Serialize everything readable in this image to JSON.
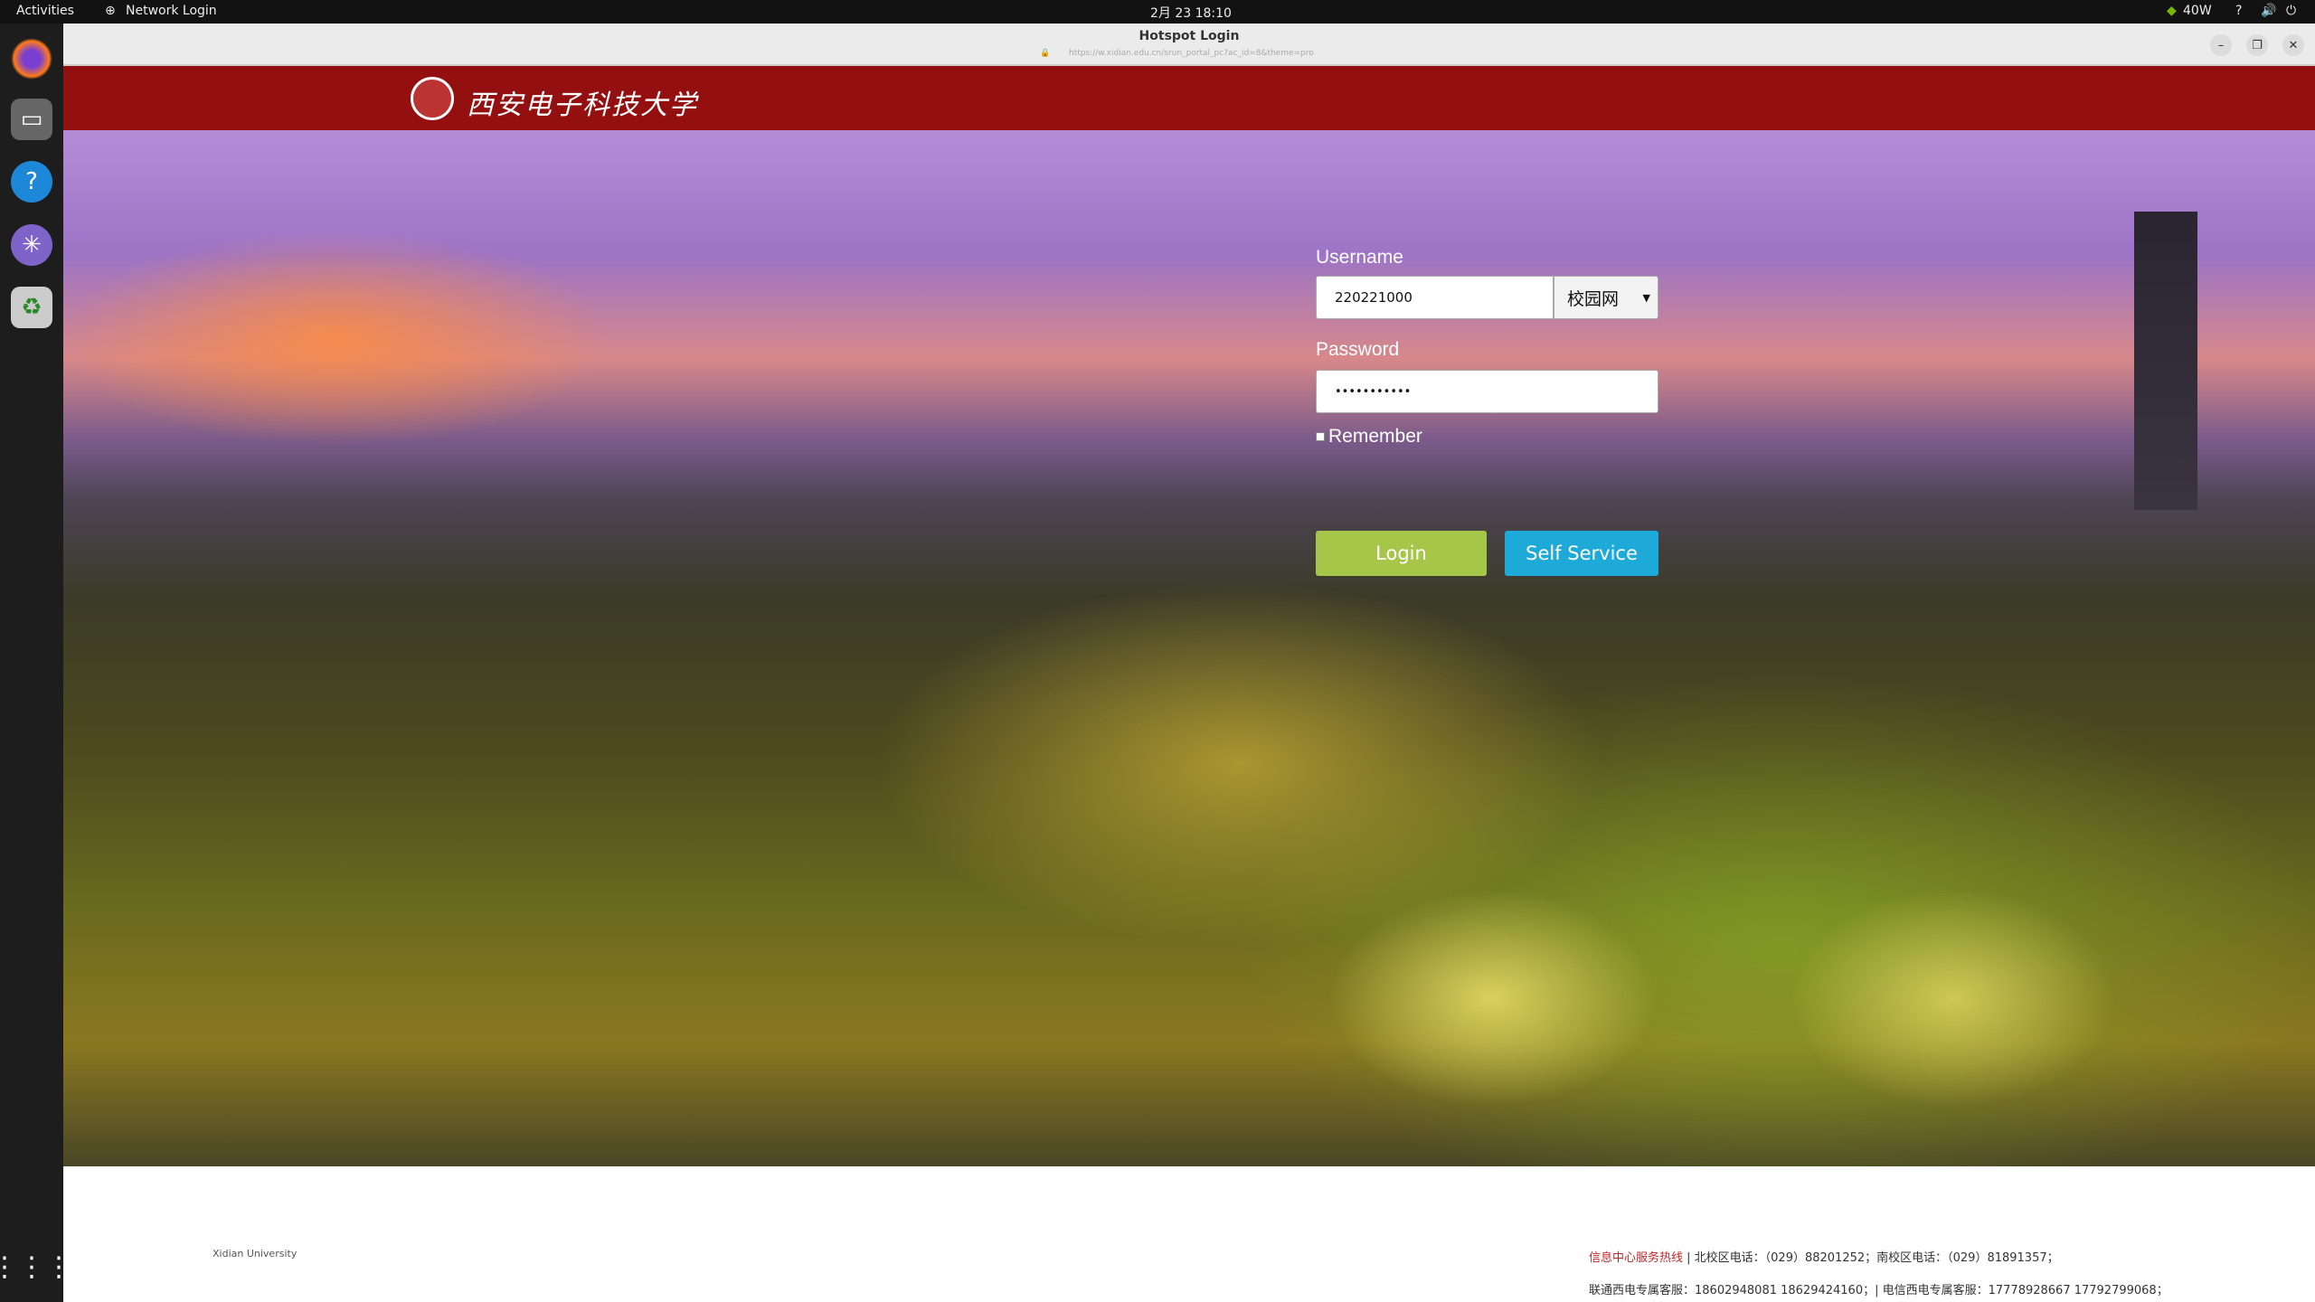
{
  "topbar": {
    "activities": "Activities",
    "app": "Network Login",
    "clock": "2月 23  18:10",
    "gpu": "40W"
  },
  "dock": {
    "items": [
      "Firefox",
      "Files",
      "Help",
      "Network Login",
      "Trash",
      "Show Applications"
    ]
  },
  "window": {
    "title": "Hotspot Login",
    "url": "https://w.xidian.edu.cn/srun_portal_pc?ac_id=8&theme=pro"
  },
  "header": {
    "logo_text": "西安电子科技大学"
  },
  "form": {
    "username_label": "Username",
    "username_value": "220221000",
    "domain_selected": "校园网",
    "password_label": "Password",
    "password_value": "•••••••••••",
    "remember_label": "Remember",
    "remember_checked": false,
    "login": "Login",
    "self_service": "Self Service",
    "login_color": "#a6c64a",
    "self_service_color": "#1eaad8"
  },
  "footer": {
    "left": "Xidian University",
    "hotline_label": "信息中心服务热线",
    "line1": " | 北校区电话：（029）88201252；南校区电话：（029）81891357；",
    "line2": "联通西电专属客服：18602948081 18629424160；| 电信西电专属客服：17778928667 17792799068；"
  }
}
